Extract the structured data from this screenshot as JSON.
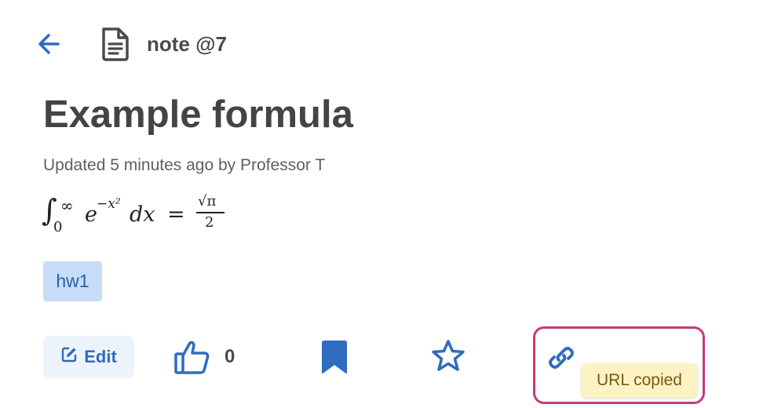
{
  "header": {
    "back_icon": "arrow-left-icon",
    "note_icon": "document-icon",
    "note_label": "note @7"
  },
  "post": {
    "title": "Example formula",
    "meta": "Updated 5 minutes ago by Professor T",
    "formula": {
      "integral": "∫",
      "lower_limit": "0",
      "upper_limit": "∞",
      "base": "e",
      "exponent": "−x²",
      "differential": "dx",
      "equals": "=",
      "numerator": "√π",
      "denominator": "2"
    },
    "tags": [
      "hw1"
    ]
  },
  "actions": {
    "edit_label": "Edit",
    "like_count": "0",
    "link_tooltip": "URL copied"
  },
  "colors": {
    "accent": "#2f6bbf",
    "tag_bg": "#c6dcf7",
    "highlight_border": "#c63a7b",
    "tooltip_bg": "#fcf2c4"
  }
}
